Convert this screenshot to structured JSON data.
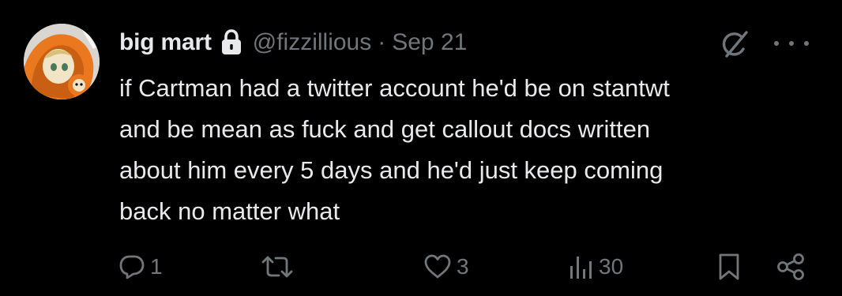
{
  "tweet": {
    "display_name": "big mart",
    "handle": "@fizzillious",
    "separator": "·",
    "date": "Sep 21",
    "text": "if Cartman had a twitter account he'd be on stantwt\nand be mean as fuck and get callout docs written\nabout him every 5 days and he'd just keep coming\nback no matter what",
    "protected": true
  },
  "icons": {
    "avatar": "avatar-kenny",
    "lock": "lock-icon",
    "grok": "grok-icon",
    "more": "more-icon",
    "reply": "reply-icon",
    "retweet": "retweet-icon",
    "like": "heart-icon",
    "views": "views-icon",
    "bookmark": "bookmark-icon",
    "share": "share-icon"
  },
  "actions": {
    "replies": "1",
    "retweets": "",
    "likes": "3",
    "views": "30"
  },
  "colors": {
    "background": "#000000",
    "primary_text": "#e7e9ea",
    "secondary_text": "#71767b",
    "avatar_orange": "#e9781f"
  }
}
